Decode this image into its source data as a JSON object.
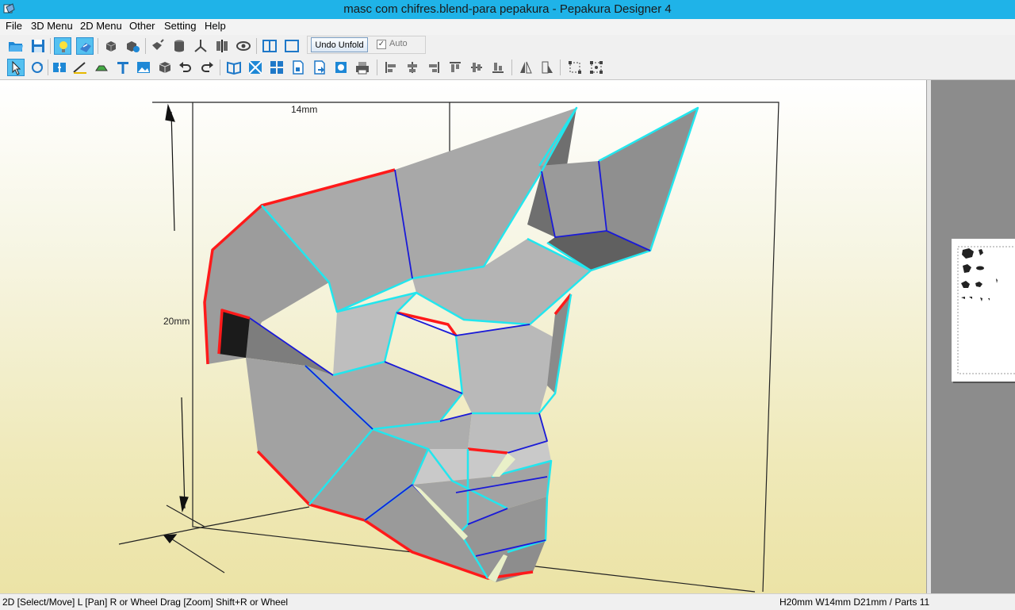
{
  "window": {
    "title": "masc com chifres.blend-para pepakura - Pepakura Designer 4"
  },
  "menu": {
    "items": [
      "File",
      "3D Menu",
      "2D Menu",
      "Other",
      "Setting",
      "Help"
    ]
  },
  "toolbar": {
    "undo_unfold_label": "Undo Unfold",
    "auto_label": "Auto",
    "auto_checked": true
  },
  "view3d": {
    "dim_width": "14mm",
    "dim_height": "20mm"
  },
  "status": {
    "left": "2D [Select/Move] L [Pan] R or Wheel Drag [Zoom] Shift+R or Wheel",
    "right": "H20mm W14mm D21mm / Parts 11"
  },
  "colors": {
    "titlebar": "#1fb3e8",
    "cut_edge": "#ff1a1a",
    "fold_edge_cyan": "#22e6ee",
    "fold_edge_blue": "#1a1ad8",
    "face_gray": "#a6a6a6"
  }
}
